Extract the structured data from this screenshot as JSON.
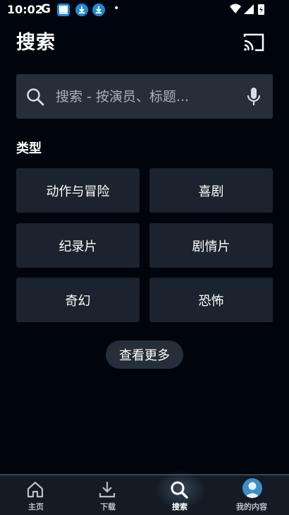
{
  "status_bar": {
    "time": "10:02",
    "g_label": "G",
    "dot": "•"
  },
  "header": {
    "title": "搜索"
  },
  "search": {
    "placeholder": "搜索 - 按演员、标题..."
  },
  "genres": {
    "heading": "类型",
    "items": [
      "动作与冒险",
      "喜剧",
      "纪录片",
      "剧情片",
      "奇幻",
      "恐怖"
    ]
  },
  "more_button": {
    "label": "查看更多"
  },
  "bottom_nav": {
    "items": [
      {
        "label": "主页",
        "icon": "home-icon",
        "active": false
      },
      {
        "label": "下载",
        "icon": "download-icon",
        "active": false
      },
      {
        "label": "搜索",
        "icon": "search-icon",
        "active": true
      },
      {
        "label": "我的内容",
        "icon": "avatar-icon",
        "active": false
      }
    ]
  },
  "colors": {
    "background": "#00050d",
    "surface": "#1a232e",
    "search_bg": "#252e39",
    "nav_bg": "#141b25",
    "app_icon_blue": "#1e8ad6"
  }
}
